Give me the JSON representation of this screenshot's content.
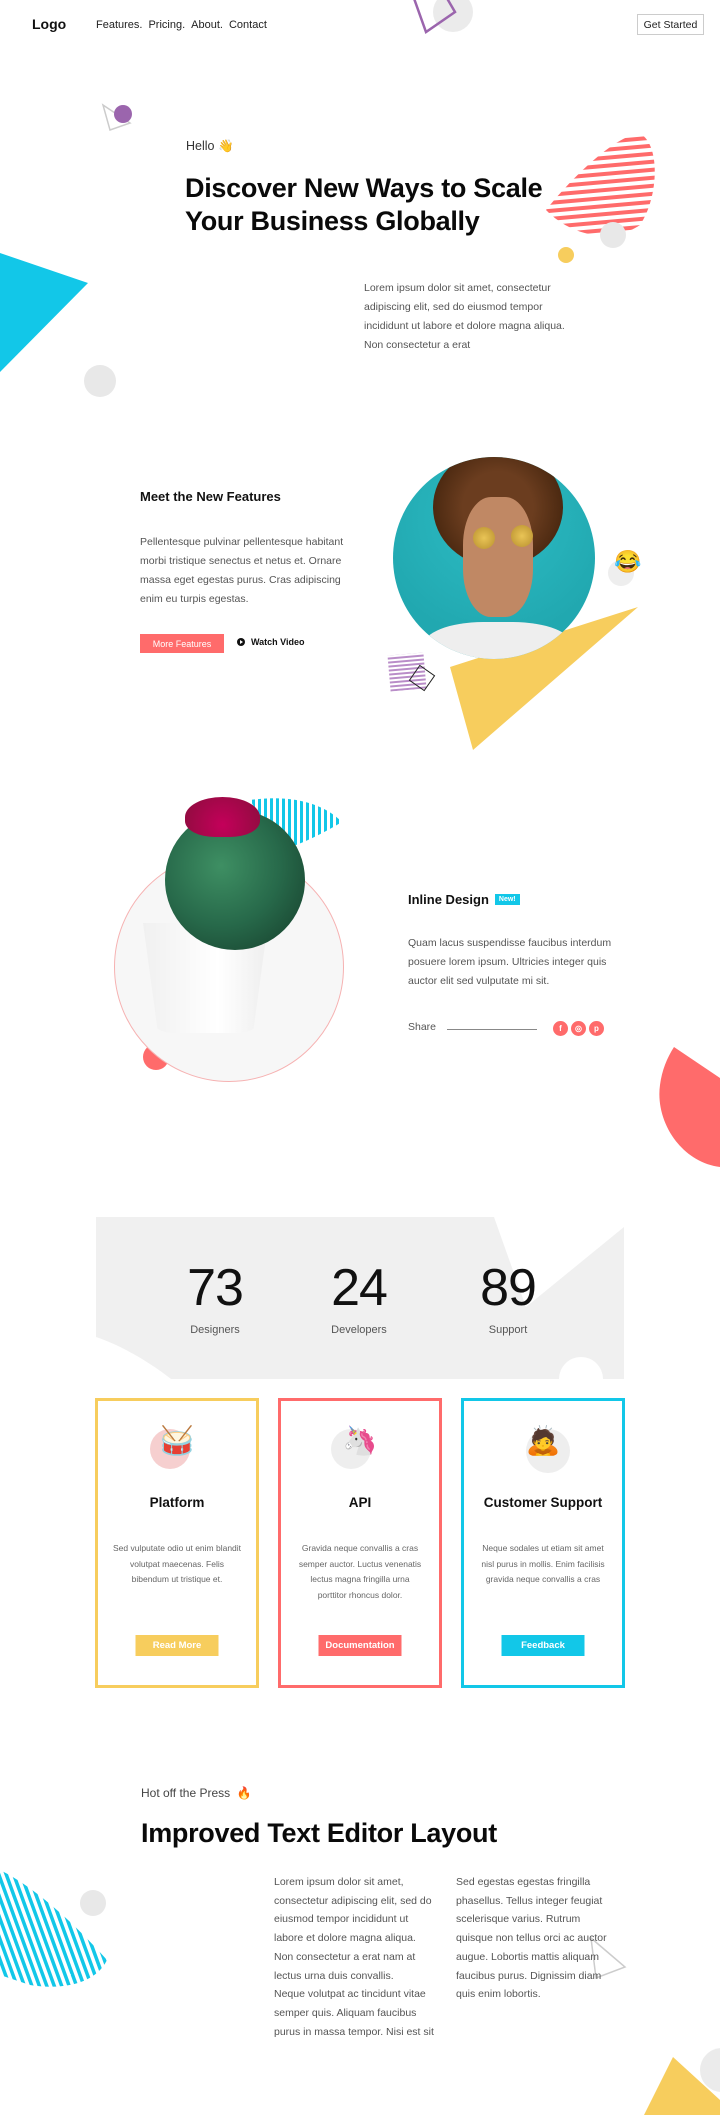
{
  "nav": {
    "logo": "Logo",
    "links": [
      "Features.",
      "Pricing.",
      "About.",
      "Contact"
    ],
    "cta": "Get Started"
  },
  "hero": {
    "greeting": "Hello",
    "greeting_emoji": "👋",
    "title_line1": "Discover New Ways to Scale",
    "title_line2": "Your Business Globally",
    "body": "Lorem ipsum dolor sit amet, consectetur adipiscing elit, sed do eiusmod tempor incididunt ut labore et dolore magna aliqua. Non consectetur a erat"
  },
  "features": {
    "title": "Meet the New Features",
    "body": "Pellentesque pulvinar pellentesque habitant morbi tristique senectus et netus et. Ornare massa eget egestas purus. Cras adipiscing enim eu turpis egestas.",
    "primary_button": "More Features",
    "secondary_button": "Watch Video",
    "emoji": "😂"
  },
  "inline_design": {
    "title": "Inline Design",
    "badge": "New!",
    "body": "Quam lacus suspendisse faucibus interdum posuere lorem ipsum. Ultricies integer quis auctor elit sed vulputate mi sit.",
    "share_label": "Share",
    "social": [
      {
        "name": "facebook",
        "glyph": "f"
      },
      {
        "name": "instagram",
        "glyph": "◎"
      },
      {
        "name": "pinterest",
        "glyph": "p"
      }
    ]
  },
  "stats": [
    {
      "value": "73",
      "label": "Designers"
    },
    {
      "value": "24",
      "label": "Developers"
    },
    {
      "value": "89",
      "label": "Support"
    }
  ],
  "cards": [
    {
      "title": "Platform",
      "body": "Sed vulputate odio ut enim blandit volutpat maecenas. Felis bibendum ut tristique et.",
      "button": "Read More",
      "icon": "🥁",
      "color": "#f7cd5d"
    },
    {
      "title": "API",
      "body": "Gravida neque convallis a cras semper auctor. Luctus venenatis lectus magna fringilla urna porttitor rhoncus dolor.",
      "button": "Documentation",
      "icon": "🦄",
      "color": "#ff6b6b"
    },
    {
      "title": "Customer Support",
      "body": "Neque sodales ut etiam sit amet nisl purus in mollis. Enim facilisis gravida neque convallis a cras",
      "button": "Feedback",
      "icon": "🙇",
      "color": "#12c7e8"
    }
  ],
  "press": {
    "subtitle": "Hot off the Press",
    "subtitle_emoji": "🔥",
    "title": "Improved Text Editor Layout",
    "col1": "Lorem ipsum dolor sit amet, consectetur adipiscing elit, sed do eiusmod tempor incididunt ut labore et dolore magna aliqua. Non consectetur a erat nam at lectus urna duis convallis.",
    "col1b": "Neque volutpat ac tincidunt vitae semper quis. Aliquam faucibus purus in massa tempor. Nisi est sit",
    "col2": "Sed egestas egestas fringilla phasellus. Tellus integer feugiat scelerisque varius. Rutrum quisque non tellus orci ac auctor augue. Lobortis mattis aliquam faucibus purus. Dignissim diam quis enim lobortis."
  },
  "colors": {
    "coral": "#ff6b6b",
    "yellow": "#f7cd5d",
    "cyan": "#12c7e8",
    "purple": "#9b65ad",
    "light_gray": "#e8e8e8"
  }
}
